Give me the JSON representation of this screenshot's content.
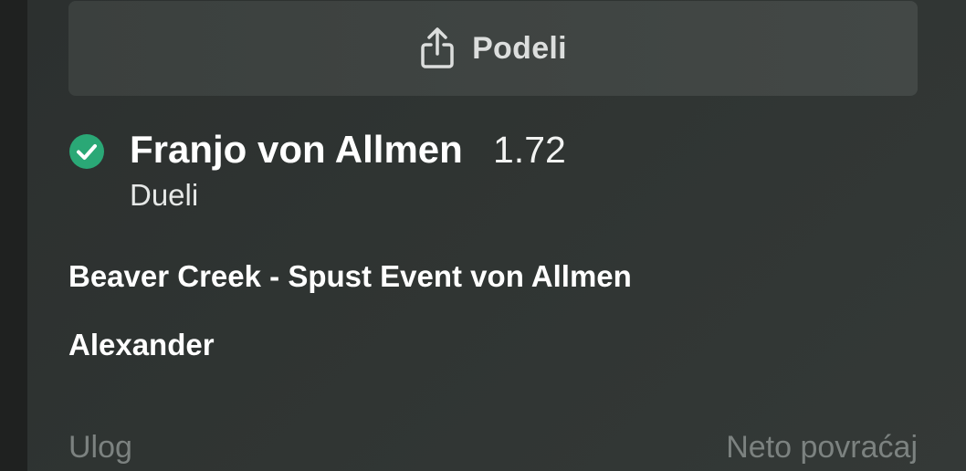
{
  "share": {
    "label": "Podeli",
    "icon": "share-icon"
  },
  "selection": {
    "name": "Franjo von Allmen",
    "odds": "1.72",
    "market": "Dueli",
    "status_icon": "check-circle-icon",
    "status_color": "#2aa876"
  },
  "event": {
    "line1": "Beaver Creek - Spust Event von Allmen",
    "line2": "Alexander"
  },
  "footer": {
    "stake_label": "Ulog",
    "net_return_label": "Neto povraćaj"
  }
}
